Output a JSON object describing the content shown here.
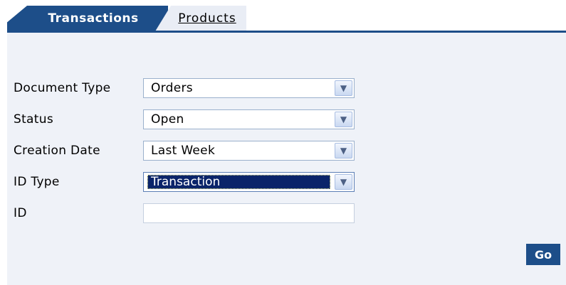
{
  "tabs": [
    {
      "label": "Transactions",
      "active": true
    },
    {
      "label": "Products",
      "active": false
    }
  ],
  "form": {
    "fields": [
      {
        "label": "Document Type",
        "value": "Orders",
        "type": "select"
      },
      {
        "label": "Status",
        "value": "Open",
        "type": "select"
      },
      {
        "label": "Creation Date",
        "value": "Last Week",
        "type": "select"
      },
      {
        "label": "ID Type",
        "value": "Transaction",
        "type": "select",
        "focused": true
      },
      {
        "label": "ID",
        "value": "",
        "type": "text"
      }
    ],
    "go_label": "Go"
  },
  "colors": {
    "accent": "#1d4e89",
    "panel_bg": "#eff2f8",
    "inactive_tab": "#e9edf5",
    "selection": "#0a246a"
  },
  "icons": {
    "dropdown": "chevron-down-icon"
  }
}
